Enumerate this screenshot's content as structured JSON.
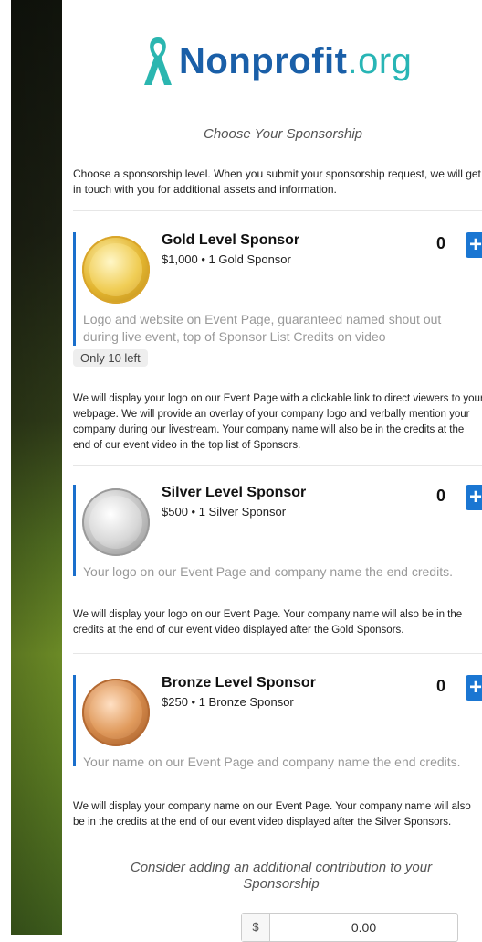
{
  "brand": {
    "name": "Nonprofit",
    "suffix": ".org",
    "ribbon_color": "#2bb6b0",
    "brand_color": "#1a5fa8"
  },
  "section_title": "Choose Your Sponsorship",
  "intro": "Choose a sponsorship level. When you submit your sponsorship request, we will get in touch with you for additional assets and information.",
  "sponsors": [
    {
      "name": "Gold Level Sponsor",
      "price": "$1,000 • 1 Gold Sponsor",
      "quantity": "0",
      "description": "Logo and website on Event Page, guaranteed named shout out during live event, top of Sponsor List Credits on video",
      "availability": "Only 10 left",
      "details": "We will display your logo on our Event Page with a clickable link to direct viewers to your webpage. We will provide an overlay of your company logo and verbally mention your company during our livestream. Your company name will also be in the credits at the end of our event video in the top list of Sponsors."
    },
    {
      "name": "Silver Level Sponsor",
      "price": "$500 • 1 Silver Sponsor",
      "quantity": "0",
      "description": "Your logo on our Event Page and company name the end credits.",
      "details": "We will display your logo on our Event Page. Your company name will also be in the credits at the end of our event video displayed after the Gold Sponsors."
    },
    {
      "name": "Bronze Level Sponsor",
      "price": "$250 • 1 Bronze Sponsor",
      "quantity": "0",
      "description": "Your name on our Event Page and company name the end credits.",
      "details": "We will display your company name on our Event Page. Your company name will also be in the credits at the end of our event video displayed after the Silver Sponsors."
    }
  ],
  "contribution": {
    "prompt": "Consider adding an additional contribution to your Sponsorship",
    "currency": "$",
    "value": "0.00"
  },
  "accent_color": "#1a76d2"
}
